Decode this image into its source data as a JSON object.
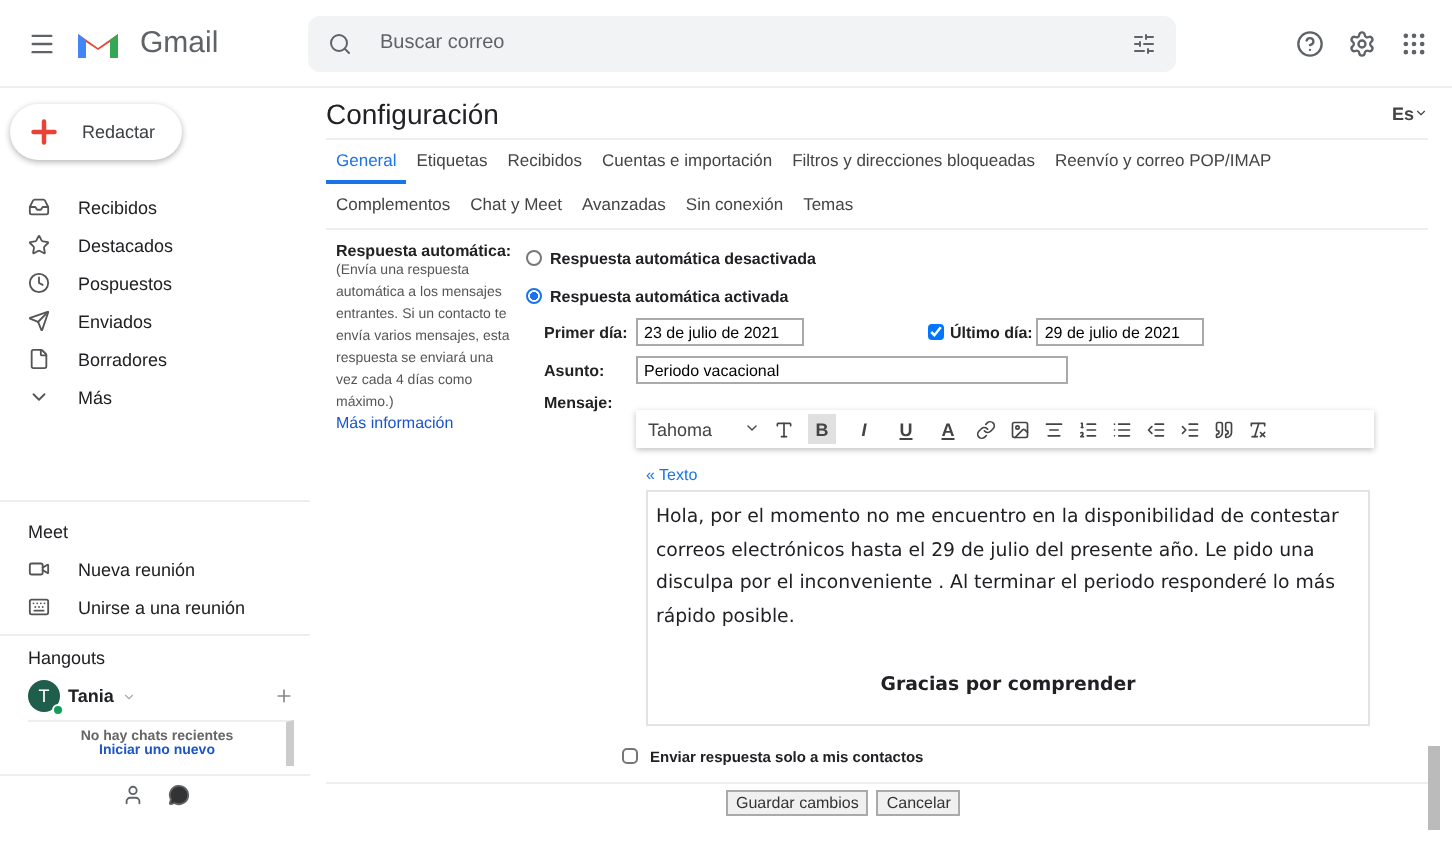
{
  "header": {
    "app_name": "Gmail",
    "search": {
      "placeholder": "Buscar correo"
    }
  },
  "sidebar": {
    "compose": "Redactar",
    "items": [
      {
        "label": "Recibidos"
      },
      {
        "label": "Destacados"
      },
      {
        "label": "Pospuestos"
      },
      {
        "label": "Enviados"
      },
      {
        "label": "Borradores"
      },
      {
        "label": "Más"
      }
    ],
    "meet": {
      "title": "Meet",
      "items": [
        {
          "label": "Nueva reunión"
        },
        {
          "label": "Unirse a una reunión"
        }
      ]
    },
    "hangouts": {
      "title": "Hangouts",
      "user": {
        "initial": "T",
        "name": "Tania",
        "online": true
      },
      "empty": "No hay chats recientes",
      "start_link": "Iniciar uno nuevo"
    }
  },
  "settings": {
    "title": "Configuración",
    "language": "Es",
    "tabs": [
      [
        {
          "label": "General",
          "selected": true
        },
        {
          "label": "Etiquetas",
          "selected": false
        },
        {
          "label": "Recibidos",
          "selected": false
        },
        {
          "label": "Cuentas e importación",
          "selected": false
        },
        {
          "label": "Filtros y direcciones bloqueadas",
          "selected": false
        },
        {
          "label": "Reenvío y correo POP/IMAP",
          "selected": false
        }
      ],
      [
        {
          "label": "Complementos",
          "selected": false
        },
        {
          "label": "Chat y Meet",
          "selected": false
        },
        {
          "label": "Avanzadas",
          "selected": false
        },
        {
          "label": "Sin conexión",
          "selected": false
        },
        {
          "label": "Temas",
          "selected": false
        }
      ]
    ],
    "auto_reply": {
      "label": "Respuesta automática:",
      "description": "(Envía una respuesta automática a los mensajes entrantes. Si un contacto te envía varios mensajes, esta respuesta se enviará una vez cada 4 días como máximo.)",
      "more_link": "Más información",
      "options": [
        {
          "label": "Respuesta automática desactivada",
          "selected": false
        },
        {
          "label": "Respuesta automática activada",
          "selected": true
        }
      ],
      "first_day": {
        "label": "Primer día:",
        "value": "23 de julio de 2021"
      },
      "last_day": {
        "label": "Último día:",
        "value": "29 de julio de 2021",
        "checked": true
      },
      "subject": {
        "label": "Asunto:",
        "value": "Periodo vacacional"
      },
      "message": {
        "label": "Mensaje:",
        "font": "Tahoma",
        "format_buttons": [
          {
            "label": "B",
            "selected": true
          },
          {
            "label": "I",
            "selected": false
          },
          {
            "label": "U",
            "selected": false
          },
          {
            "label": "A",
            "selected": false
          }
        ],
        "plain_text_link": "« Texto",
        "body": "Hola, por el momento no me encuentro en la disponibilidad de contestar correos electrónicos hasta el 29 de julio del presente año. Le pido una disculpa por el inconveniente . Al terminar el periodo responderé lo más rápido posible.",
        "closing": "Gracias por comprender"
      },
      "contacts_only": {
        "label": "Enviar respuesta solo a mis contactos",
        "checked": false
      }
    },
    "buttons": [
      "Guardar cambios",
      "Cancelar"
    ]
  }
}
